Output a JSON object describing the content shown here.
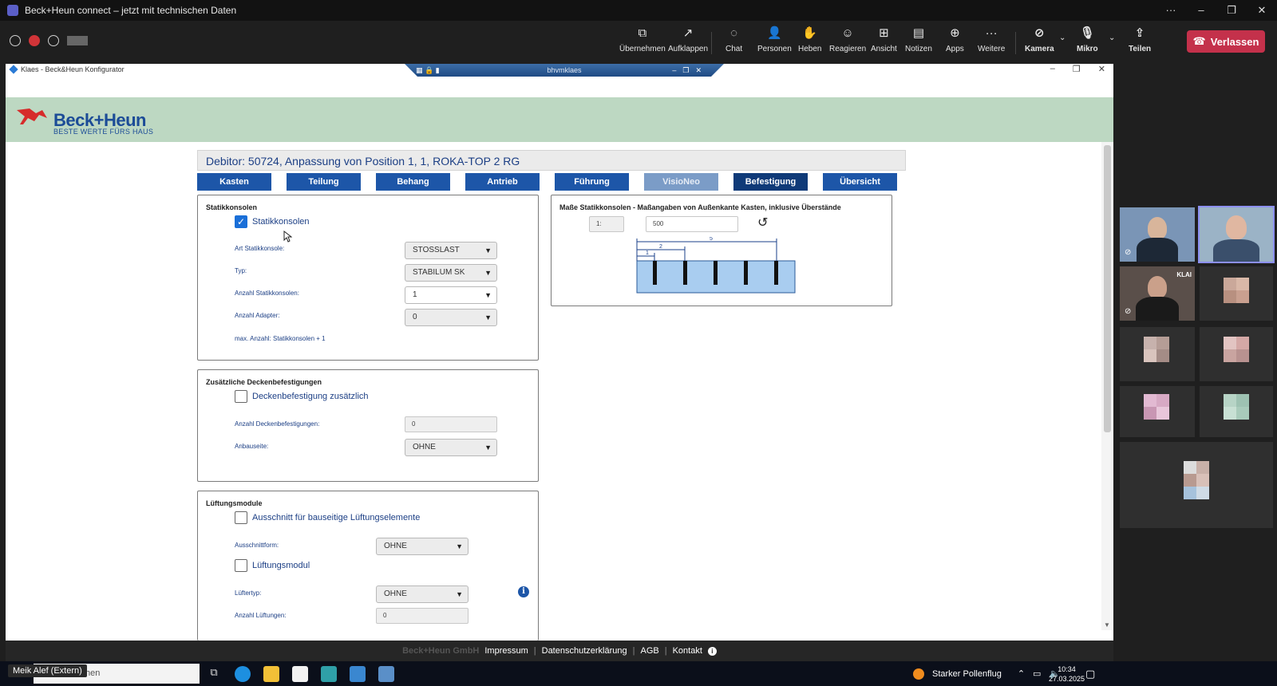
{
  "teams": {
    "window_title": "Beck+Heun connect – jetzt mit technischen Daten",
    "window_controls": {
      "more": "···",
      "minimize": "–",
      "restore": "❐",
      "close": "✕"
    },
    "toolbar": [
      {
        "label": "Übernehmen",
        "icon": "screen-share-icon"
      },
      {
        "label": "Aufklappen",
        "icon": "popout-icon"
      },
      {
        "label": "Chat",
        "icon": "chat-icon"
      },
      {
        "label": "Personen",
        "icon": "people-icon"
      },
      {
        "label": "Heben",
        "icon": "raise-hand-icon"
      },
      {
        "label": "Reagieren",
        "icon": "smiley-icon"
      },
      {
        "label": "Ansicht",
        "icon": "grid-view-icon"
      },
      {
        "label": "Notizen",
        "icon": "notes-icon"
      },
      {
        "label": "Apps",
        "icon": "apps-plus-icon"
      },
      {
        "label": "Weitere",
        "icon": "more-icon"
      },
      {
        "label": "Kamera",
        "icon": "camera-off-icon"
      },
      {
        "label": "Mikro",
        "icon": "mic-off-icon"
      },
      {
        "label": "Teilen",
        "icon": "share-tray-icon"
      }
    ],
    "leave_label": "Verlassen",
    "leave_color": "#c4314b"
  },
  "remote": {
    "window_title": "Klaes - Beck&Heun Konfigurator",
    "session_name": "bhvmklaes",
    "window_controls": {
      "minimize": "–",
      "restore": "❐",
      "close": "✕"
    }
  },
  "brand": {
    "name": "Beck+Heun",
    "tagline": "BESTE WERTE FÜRS HAUS",
    "band_color": "#bdd8c2",
    "text_color": "#1c4c97",
    "mark_color": "#d62b2b"
  },
  "debitor_title": "Debitor: 50724, Anpassung von Position 1, 1, ROKA-TOP 2 RG",
  "tabs": [
    {
      "label": "Kasten",
      "state": "normal"
    },
    {
      "label": "Teilung",
      "state": "normal"
    },
    {
      "label": "Behang",
      "state": "normal"
    },
    {
      "label": "Antrieb",
      "state": "normal"
    },
    {
      "label": "Führung",
      "state": "normal"
    },
    {
      "label": "VisioNeo",
      "state": "disabled"
    },
    {
      "label": "Befestigung",
      "state": "active"
    },
    {
      "label": "Übersicht",
      "state": "normal"
    }
  ],
  "statik": {
    "title": "Statikkonsolen",
    "checkbox_label": "Statikkonsolen",
    "checked": true,
    "art_label": "Art Statikkonsole:",
    "art_value": "STOSSLAST",
    "typ_label": "Typ:",
    "typ_value": "STABILUM SK",
    "anzahl_label": "Anzahl Statikkonsolen:",
    "anzahl_value": "1",
    "adapter_label": "Anzahl Adapter:",
    "adapter_value": "0",
    "max_note": "max. Anzahl: Statikkonsolen + 1"
  },
  "decke": {
    "title": "Zusätzliche Deckenbefestigungen",
    "checkbox_label": "Deckenbefestigung zusätzlich",
    "checked": false,
    "anzahl_label": "Anzahl Deckenbefestigungen:",
    "anzahl_value": "0",
    "anbau_label": "Anbauseite:",
    "anbau_value": "OHNE"
  },
  "lueftung": {
    "title": "Lüftungsmodule",
    "ausschnitt_checkbox": "Ausschnitt für bauseitige Lüftungselemente",
    "ausschnitt_checked": false,
    "ausschnittform_label": "Ausschnittform:",
    "ausschnittform_value": "OHNE",
    "modul_checkbox": "Lüftungsmodul",
    "modul_checked": false,
    "luftertyp_label": "Lüftertyp:",
    "luftertyp_value": "OHNE",
    "anzahl_label": "Anzahl Lüftungen:",
    "anzahl_value": "0",
    "info_glyph": "i"
  },
  "masse": {
    "title": "Maße Statikkonsolen - Maßangaben von Außenkante Kasten, inklusive Überstände",
    "index_value": "1:",
    "value": "500",
    "reset_glyph": "↺",
    "dim_labels": [
      "1",
      "2",
      "5"
    ]
  },
  "footer": {
    "company": "Beck+Heun GmbH",
    "links": [
      "Impressum",
      "Datenschutzerklärung",
      "AGB",
      "Kontakt"
    ],
    "info_glyph": "i"
  },
  "participants": {
    "tile_label": "KLAI"
  },
  "taskbar": {
    "name_tag": "Meik Alef (Extern)",
    "search_text": "Suchen",
    "weather": "Starker Pollenflug",
    "time": "10:34",
    "date": "27.03.2025"
  }
}
